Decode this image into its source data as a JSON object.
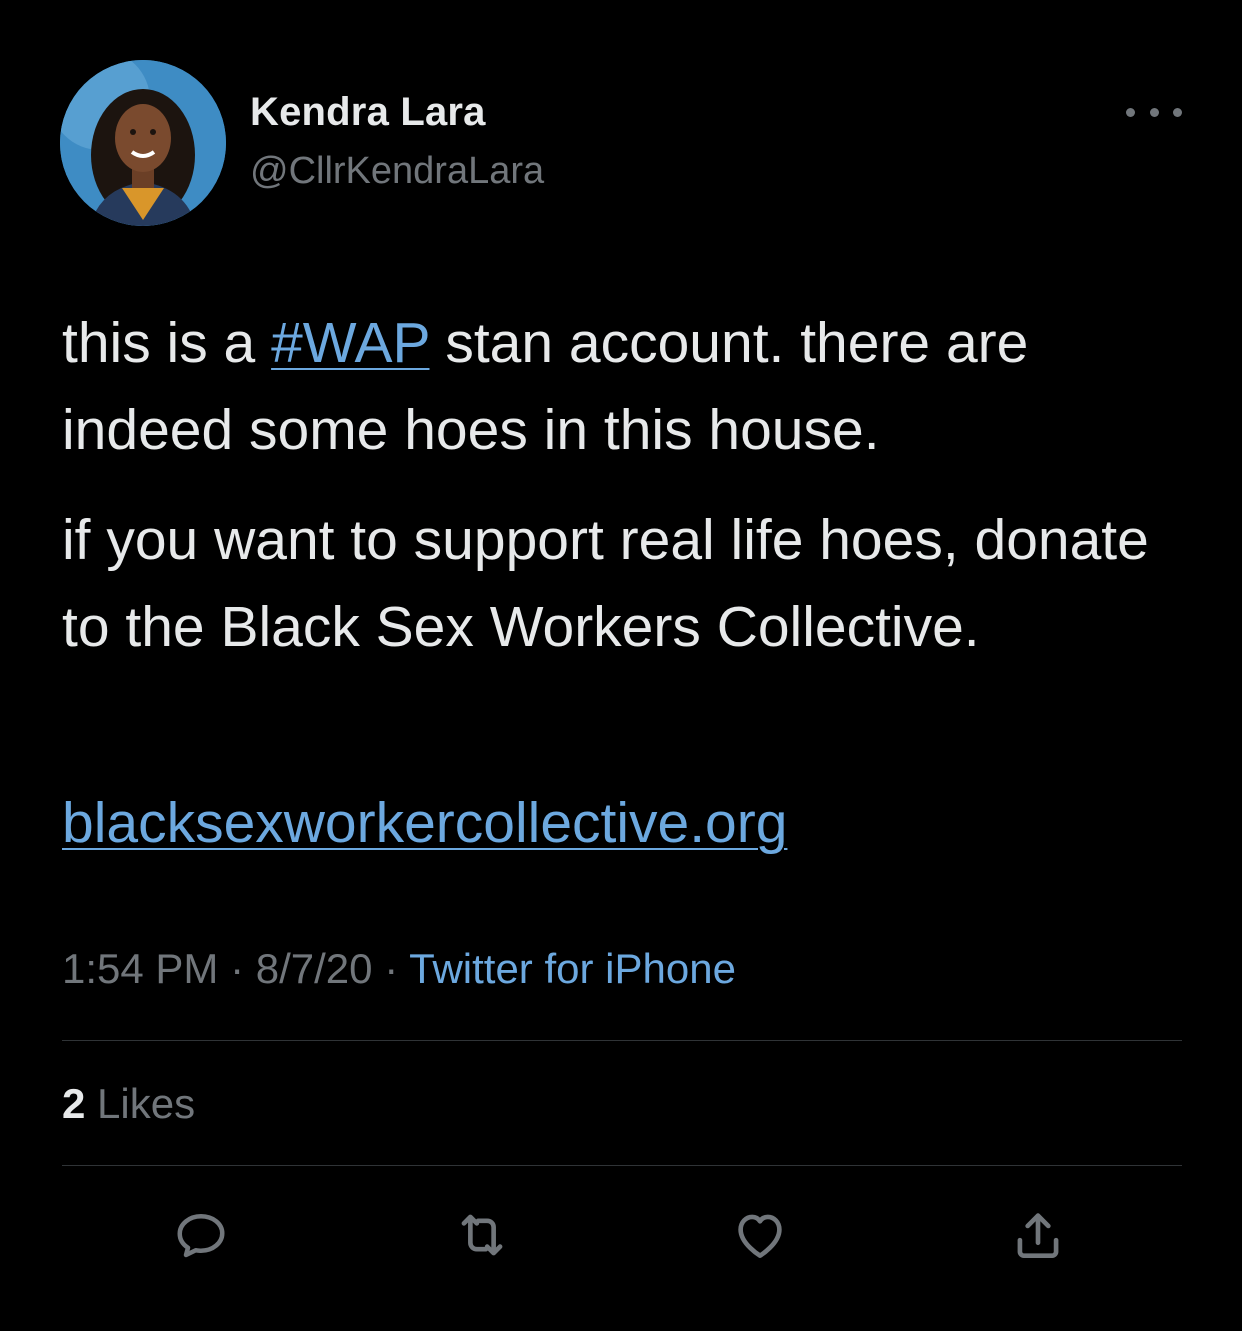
{
  "author": {
    "display_name": "Kendra Lara",
    "handle": "@CllrKendraLara"
  },
  "tweet": {
    "text_part1_before": "this is a ",
    "hashtag": "#WAP",
    "text_part1_after": " stan account. there are indeed some hoes in this house.",
    "text_part2": "if you want to support real life hoes, donate to the Black Sex Workers Collective.",
    "url": "blacksexworkercollective.org"
  },
  "meta": {
    "time": "1:54 PM",
    "separator": " · ",
    "date": "8/7/20",
    "source": "Twitter for iPhone"
  },
  "stats": {
    "likes_count": "2",
    "likes_label": " Likes"
  },
  "icons": {
    "more": "more-icon",
    "reply": "reply-icon",
    "retweet": "retweet-icon",
    "like": "heart-icon",
    "share": "share-icon"
  },
  "colors": {
    "background": "#000000",
    "text_primary": "#e7e9ea",
    "text_secondary": "#71767b",
    "link": "#6ca8df",
    "divider": "#2f3336"
  }
}
